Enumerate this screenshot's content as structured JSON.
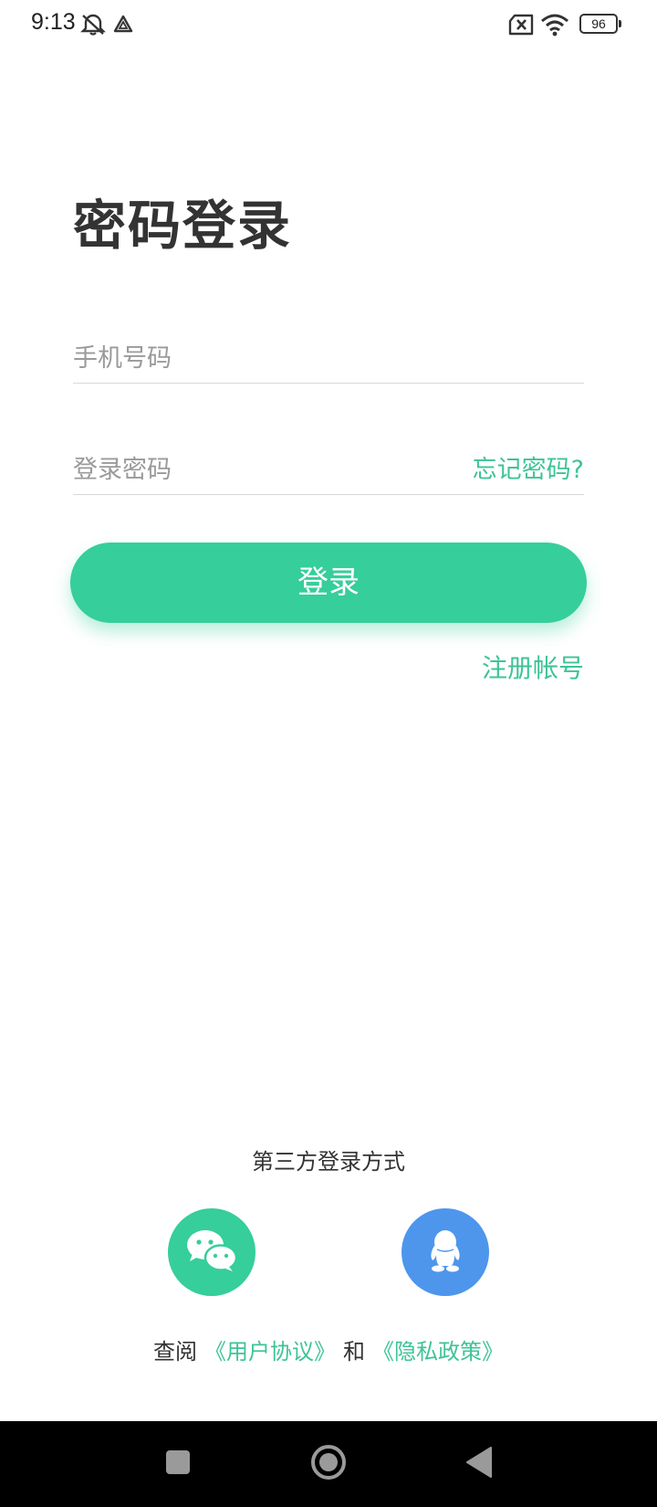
{
  "status_bar": {
    "time": "9:13",
    "battery": "96",
    "icons": [
      "mute-alarm-icon",
      "drive-icon",
      "no-sim-icon",
      "wifi-icon",
      "battery-icon"
    ]
  },
  "title": "密码登录",
  "phone_field": {
    "placeholder": "手机号码"
  },
  "password_field": {
    "placeholder": "登录密码",
    "forgot_label": "忘记密码?"
  },
  "login_button": "登录",
  "register_link": "注册帐号",
  "third_party": {
    "title": "第三方登录方式",
    "options": [
      {
        "icon": "wechat-icon",
        "color": "#36ce9a"
      },
      {
        "icon": "qq-icon",
        "color": "#4d96ec"
      }
    ]
  },
  "agreement": {
    "prefix": "查阅",
    "user_agreement": "《用户协议》",
    "and": "和",
    "privacy_policy": "《隐私政策》"
  },
  "nav_bar": {
    "buttons": [
      "recents-icon",
      "home-icon",
      "back-icon"
    ]
  },
  "colors": {
    "accent": "#36ce9a",
    "link": "#3dc496",
    "qq_blue": "#4d96ec"
  }
}
